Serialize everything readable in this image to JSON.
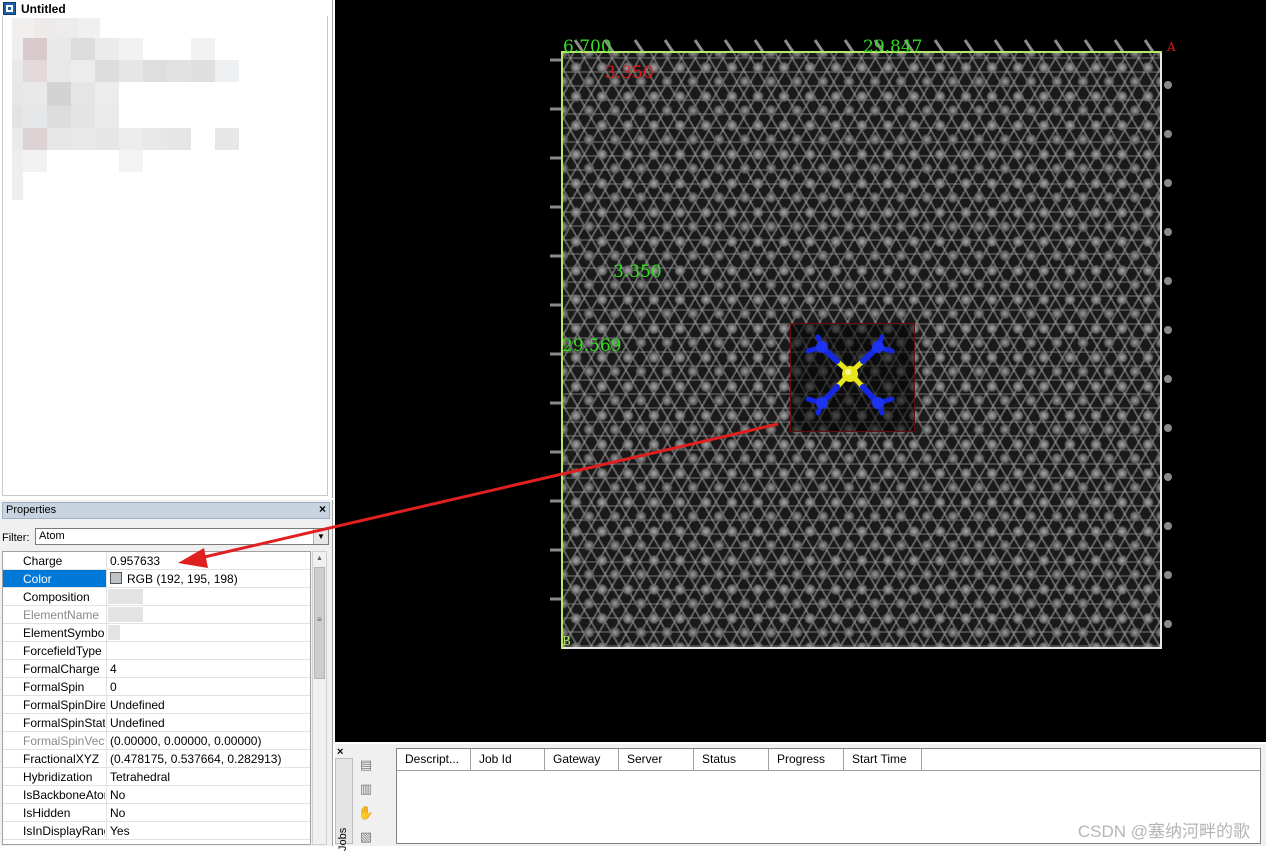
{
  "tree": {
    "title": "Untitled",
    "icon": "document-icon"
  },
  "properties": {
    "title": "Properties",
    "close_symbol": "×",
    "filter_label": "Filter:",
    "filter_value": "Atom",
    "rows": [
      {
        "name": "Charge",
        "value": "0.957633",
        "selected": false,
        "disabled": false
      },
      {
        "name": "Color",
        "value": "RGB (192, 195, 198)",
        "selected": true,
        "disabled": false,
        "swatch": "#c0c3c6"
      },
      {
        "name": "Composition",
        "value": "",
        "selected": false,
        "disabled": false
      },
      {
        "name": "ElementName",
        "value": "",
        "selected": false,
        "disabled": true
      },
      {
        "name": "ElementSymbol",
        "value": "",
        "selected": false,
        "disabled": false
      },
      {
        "name": "ForcefieldType",
        "value": "",
        "selected": false,
        "disabled": false
      },
      {
        "name": "FormalCharge",
        "value": "4",
        "selected": false,
        "disabled": false
      },
      {
        "name": "FormalSpin",
        "value": "0",
        "selected": false,
        "disabled": false
      },
      {
        "name": "FormalSpinDirection",
        "value": "Undefined",
        "selected": false,
        "disabled": false
      },
      {
        "name": "FormalSpinState",
        "value": "Undefined",
        "selected": false,
        "disabled": false
      },
      {
        "name": "FormalSpinVector",
        "value": "(0.00000, 0.00000, 0.00000)",
        "selected": false,
        "disabled": true
      },
      {
        "name": "FractionalXYZ",
        "value": "(0.478175, 0.537664, 0.282913)",
        "selected": false,
        "disabled": false
      },
      {
        "name": "Hybridization",
        "value": "Tetrahedral",
        "selected": false,
        "disabled": false
      },
      {
        "name": "IsBackboneAtom",
        "value": "No",
        "selected": false,
        "disabled": false
      },
      {
        "name": "IsHidden",
        "value": "No",
        "selected": false,
        "disabled": false
      },
      {
        "name": "IsInDisplayRange",
        "value": "Yes",
        "selected": false,
        "disabled": false
      }
    ]
  },
  "viewer": {
    "labels": {
      "top_left": "6.700",
      "top_center": "29.847",
      "red_upper": "3.350",
      "mid_left": "3.350",
      "side_left": "29.569",
      "axis_a": "A",
      "axis_b": "B"
    },
    "colors": {
      "background": "#000000",
      "carbon": "#7a7a7a",
      "silicon": "#e6e619",
      "nitrogen": "#1428e0",
      "label_green": "#33e020",
      "label_red": "#e01a1a",
      "selection": "#e02020",
      "arrow": "#e02020"
    }
  },
  "jobs": {
    "tab_label": "Jobs",
    "close_symbol": "×",
    "toolbar_icons": [
      "job-properties-icon",
      "job-list-icon",
      "job-stop-icon",
      "job-download-icon"
    ],
    "columns": [
      "Descript...",
      "Job Id",
      "Gateway",
      "Server",
      "Status",
      "Progress",
      "Start Time"
    ]
  },
  "watermark": "CSDN @塞纳河畔的歌"
}
